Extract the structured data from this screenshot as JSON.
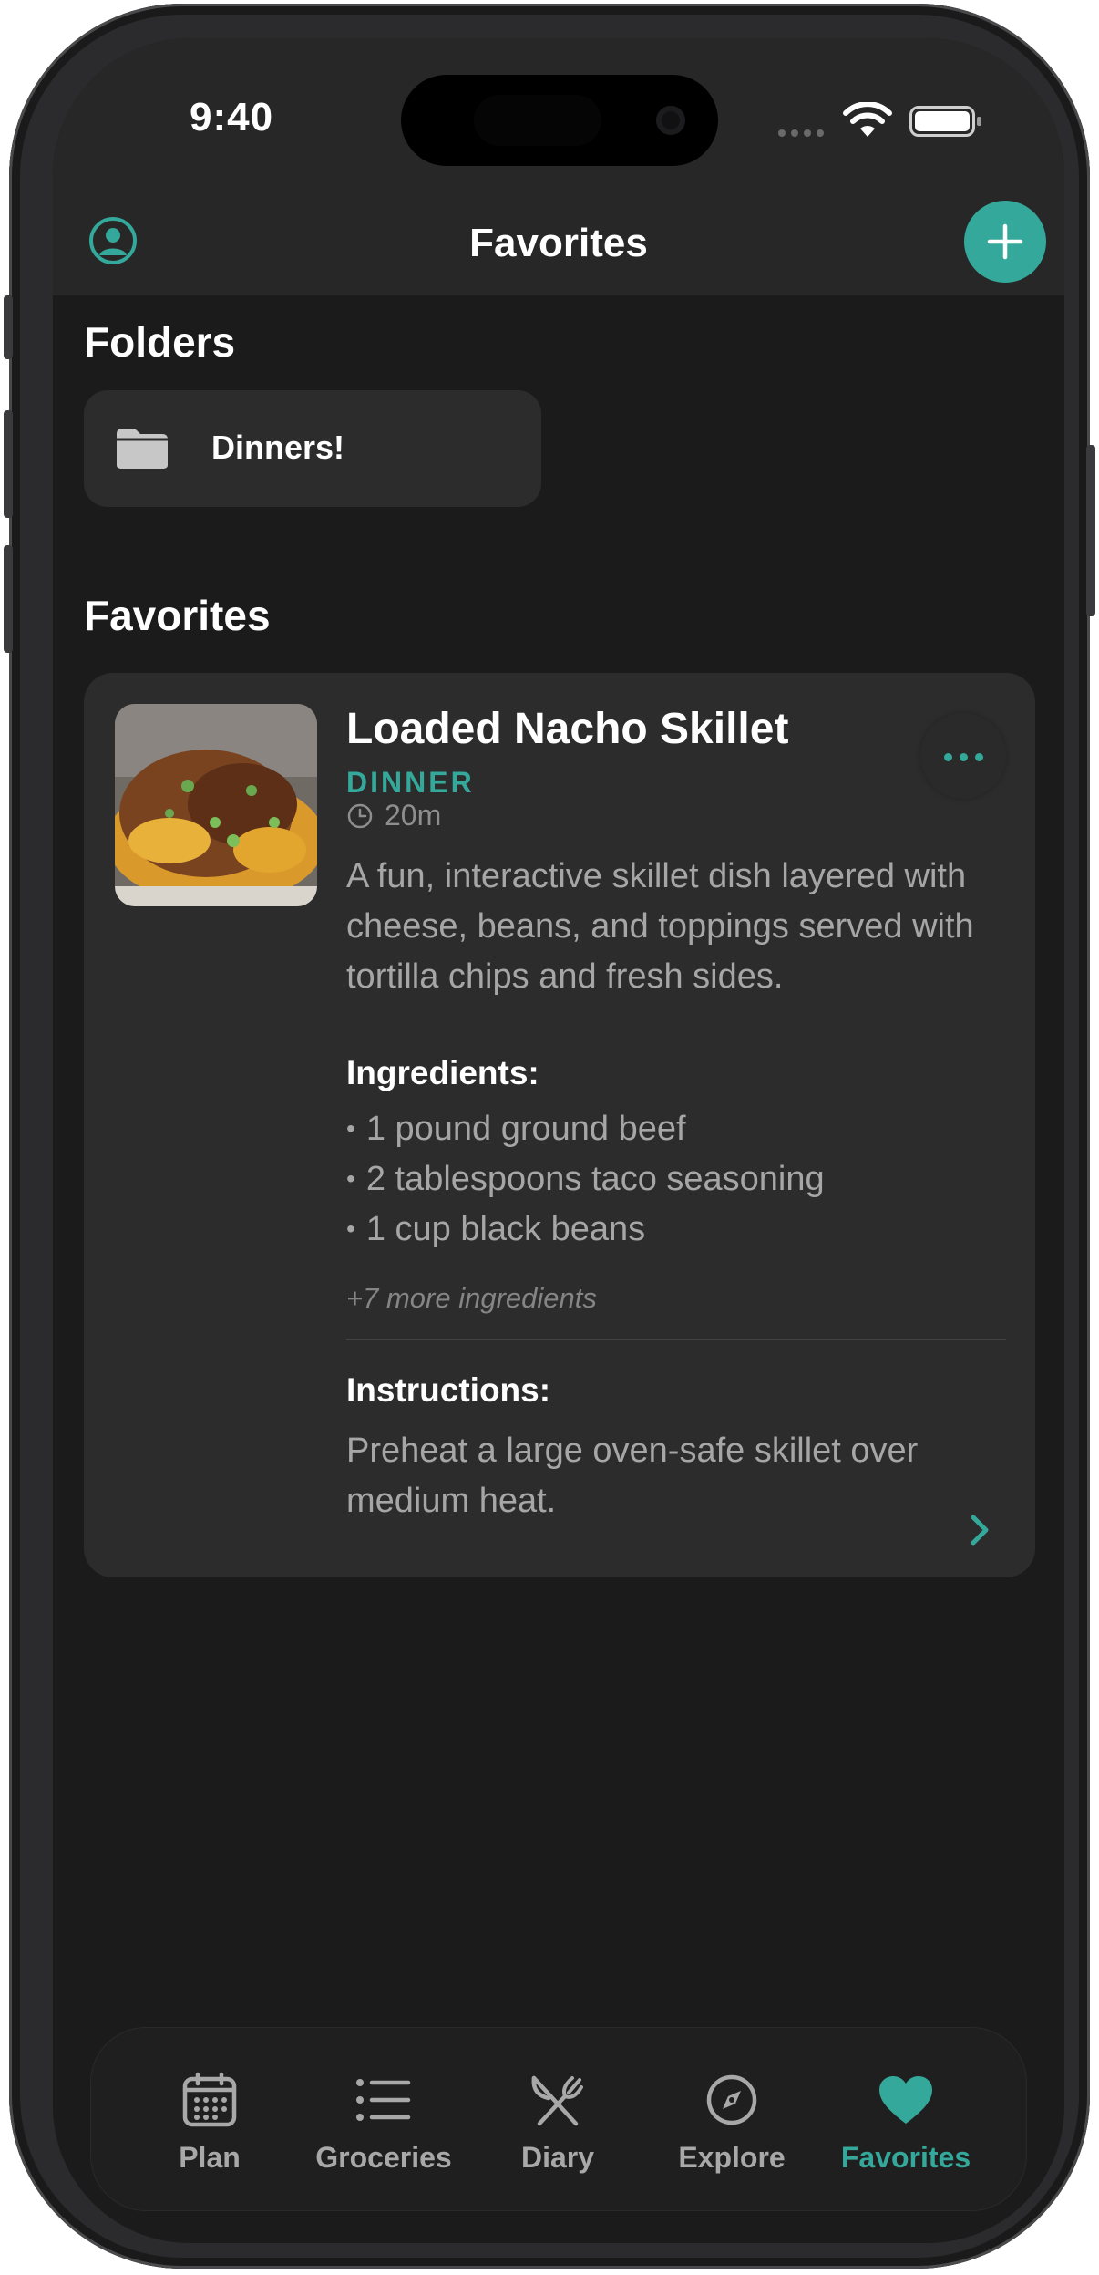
{
  "status_bar": {
    "time": "9:40"
  },
  "header": {
    "title": "Favorites"
  },
  "folders_section": {
    "title": "Folders",
    "folders": [
      {
        "label": "Dinners!"
      }
    ]
  },
  "favorites_section": {
    "title": "Favorites",
    "recipe": {
      "title": "Loaded Nacho Skillet",
      "category": "DINNER",
      "time": "20m",
      "description": "A fun, interactive skillet dish layered with cheese, beans, and toppings served with tortilla chips and fresh sides.",
      "ingredients_heading": "Ingredients:",
      "ingredients": [
        "1 pound ground beef",
        "2 tablespoons taco seasoning",
        "1 cup black beans"
      ],
      "more_ingredients": "+7 more ingredients",
      "instructions_heading": "Instructions:",
      "instructions": "Preheat a large oven-safe skillet over medium heat."
    }
  },
  "tab_bar": {
    "tabs": [
      {
        "label": "Plan",
        "icon": "calendar-icon"
      },
      {
        "label": "Groceries",
        "icon": "list-icon"
      },
      {
        "label": "Diary",
        "icon": "fork-knife-icon"
      },
      {
        "label": "Explore",
        "icon": "compass-icon"
      },
      {
        "label": "Favorites",
        "icon": "heart-icon",
        "active": true
      }
    ]
  },
  "colors": {
    "accent": "#34a89a",
    "background": "#1b1b1b",
    "card": "#2c2c2c",
    "header": "#272727"
  }
}
